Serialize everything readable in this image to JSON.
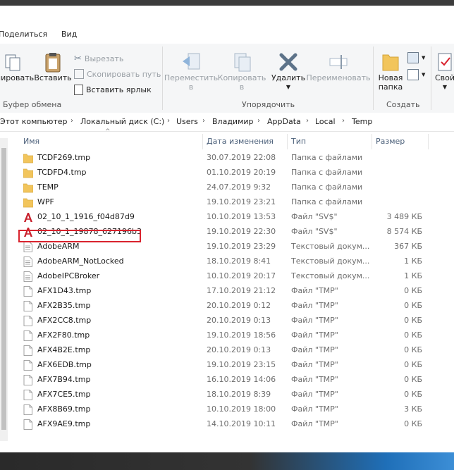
{
  "menu": {
    "share": "Поделиться",
    "view": "Вид"
  },
  "ribbon": {
    "copy": "пировать",
    "paste": "Вставить",
    "cut": "Вырезать",
    "copy_path": "Скопировать путь",
    "paste_shortcut": "Вставить ярлык",
    "clipboard_group": "Буфер обмена",
    "move_to": "Переместить",
    "move_to_sub": "в",
    "copy_to": "Копировать",
    "copy_to_sub": "в",
    "delete": "Удалить",
    "rename": "Переименовать",
    "organize_group": "Упорядочить",
    "new_folder_1": "Новая",
    "new_folder_2": "папка",
    "create_group": "Создать",
    "properties": "Свой"
  },
  "breadcrumb": [
    "Этот компьютер",
    "Локальный диск (C:)",
    "Users",
    "Владимир",
    "AppData",
    "Local",
    "Temp"
  ],
  "columns": {
    "name": "Имя",
    "date": "Дата изменения",
    "type": "Тип",
    "size": "Размер"
  },
  "colors": {
    "highlight": "#d9232e",
    "folder": "#f2c55c",
    "accent": "#1f6fb8"
  },
  "files": [
    {
      "name": "TCDF269.tmp",
      "date": "30.07.2019 22:08",
      "type": "Папка с файлами",
      "size": "",
      "icon": "folder-icon"
    },
    {
      "name": "TCDFD4.tmp",
      "date": "01.10.2019 20:19",
      "type": "Папка с файлами",
      "size": "",
      "icon": "folder-icon"
    },
    {
      "name": "TEMP",
      "date": "24.07.2019 9:32",
      "type": "Папка с файлами",
      "size": "",
      "icon": "folder-icon"
    },
    {
      "name": "WPF",
      "date": "19.10.2019 23:21",
      "type": "Папка с файлами",
      "size": "",
      "icon": "folder-icon"
    },
    {
      "name": "02_10_1_1916_f04d87d9",
      "date": "10.10.2019 13:53",
      "type": "Файл \"SV$\"",
      "size": "3 489 КБ",
      "icon": "autocad-icon"
    },
    {
      "name": "02_10_1_19878_627196b3",
      "date": "19.10.2019 22:30",
      "type": "Файл \"SV$\"",
      "size": "8 574 КБ",
      "icon": "autocad-icon"
    },
    {
      "name": "AdobeARM",
      "date": "19.10.2019 23:29",
      "type": "Текстовый докум...",
      "size": "367 КБ",
      "icon": "text-file-icon"
    },
    {
      "name": "AdobeARM_NotLocked",
      "date": "18.10.2019 8:41",
      "type": "Текстовый докум...",
      "size": "1 КБ",
      "icon": "text-file-icon"
    },
    {
      "name": "AdobeIPCBroker",
      "date": "10.10.2019 20:17",
      "type": "Текстовый докум...",
      "size": "1 КБ",
      "icon": "text-file-icon"
    },
    {
      "name": "AFX1D43.tmp",
      "date": "17.10.2019 21:12",
      "type": "Файл \"TMP\"",
      "size": "0 КБ",
      "icon": "file-icon"
    },
    {
      "name": "AFX2B35.tmp",
      "date": "20.10.2019 0:12",
      "type": "Файл \"TMP\"",
      "size": "0 КБ",
      "icon": "file-icon"
    },
    {
      "name": "AFX2CC8.tmp",
      "date": "20.10.2019 0:13",
      "type": "Файл \"TMP\"",
      "size": "0 КБ",
      "icon": "file-icon"
    },
    {
      "name": "AFX2F80.tmp",
      "date": "19.10.2019 18:56",
      "type": "Файл \"TMP\"",
      "size": "0 КБ",
      "icon": "file-icon"
    },
    {
      "name": "AFX4B2E.tmp",
      "date": "20.10.2019 0:13",
      "type": "Файл \"TMP\"",
      "size": "0 КБ",
      "icon": "file-icon"
    },
    {
      "name": "AFX6EDB.tmp",
      "date": "19.10.2019 23:15",
      "type": "Файл \"TMP\"",
      "size": "0 КБ",
      "icon": "file-icon"
    },
    {
      "name": "AFX7B94.tmp",
      "date": "16.10.2019 14:06",
      "type": "Файл \"TMP\"",
      "size": "0 КБ",
      "icon": "file-icon"
    },
    {
      "name": "AFX7CE5.tmp",
      "date": "18.10.2019 8:39",
      "type": "Файл \"TMP\"",
      "size": "0 КБ",
      "icon": "file-icon"
    },
    {
      "name": "AFX8B69.tmp",
      "date": "10.10.2019 18:00",
      "type": "Файл \"TMP\"",
      "size": "3 КБ",
      "icon": "file-icon"
    },
    {
      "name": "AFX9AE9.tmp",
      "date": "14.10.2019 10:11",
      "type": "Файл \"TMP\"",
      "size": "0 КБ",
      "icon": "file-icon"
    }
  ]
}
